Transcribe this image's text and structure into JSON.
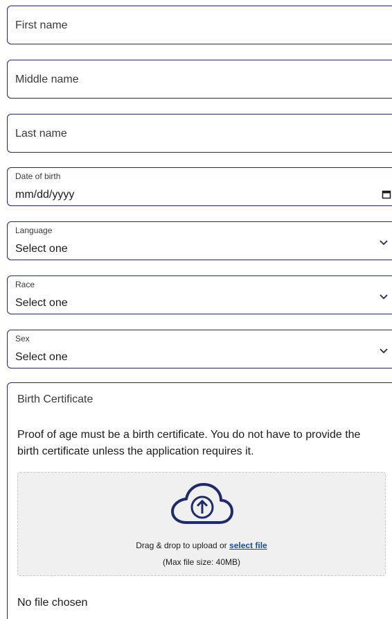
{
  "form": {
    "first_name": {
      "placeholder": "First name"
    },
    "middle_name": {
      "placeholder": "Middle name"
    },
    "last_name": {
      "placeholder": "Last name"
    },
    "dob": {
      "label": "Date of birth",
      "value": "mm/dd/yyyy",
      "icon": "calendar-icon"
    },
    "language": {
      "label": "Language",
      "value": "Select one",
      "icon": "chevron-down-icon"
    },
    "race": {
      "label": "Race",
      "value": "Select one",
      "icon": "chevron-down-icon"
    },
    "sex": {
      "label": "Sex",
      "value": "Select one",
      "icon": "chevron-down-icon"
    }
  },
  "upload": {
    "title": "Birth Certificate",
    "description": "Proof of age must be a birth certificate. You do not have to provide the birth certificate unless the application requires it.",
    "drop_text": "Drag & drop to upload or ",
    "select_link": "select file",
    "max_size": "(Max file size: 40MB)",
    "status": "No file chosen",
    "icon": "cloud-upload-icon"
  },
  "colors": {
    "border": "#1d2a6b",
    "link": "#1d4a9b",
    "dropzone_bg": "#f0f0f0"
  }
}
